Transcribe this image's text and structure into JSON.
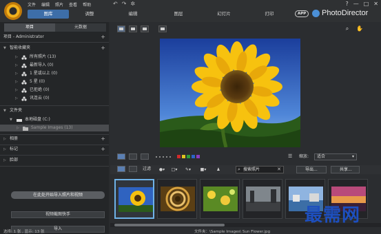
{
  "menu": [
    "文件",
    "编辑",
    "照片",
    "查看",
    "帮助"
  ],
  "window_controls": [
    "?",
    "—",
    "□",
    "✕"
  ],
  "main_tabs": [
    "图库",
    "调整",
    "编辑",
    "图层",
    "幻灯片",
    "打印"
  ],
  "app_badge": "APP",
  "brand": "PhotoDirector",
  "left": {
    "tabs": [
      "项目",
      "元数据"
    ],
    "project_label": "项目 - Administrator",
    "smart_collections": "智能收藏夹",
    "smart_items": [
      "所有照片 (13)",
      "最新导入 (0)",
      "1 星或以上 (0)",
      "5 星 (0)",
      "已拒绝 (0)",
      "讯连云 (0)"
    ],
    "folders": "文件夹",
    "local_disk": "本地磁盘 (C:)",
    "sample_folder": "Sample Images (13)",
    "albums": "相册",
    "tags": "标记",
    "faces": "脸部",
    "start_button": "在此处开始导入照片和视频",
    "video_button": "视频截图快手",
    "import_button": "导入"
  },
  "filmstrip": {
    "zoom_label": "缩放:",
    "zoom_value": "适合",
    "swatch_colors": [
      "#d02a2a",
      "#e0c420",
      "#2c9e3a",
      "#2d63c8",
      "#8a3cc0"
    ]
  },
  "filter": {
    "filter_label": "过滤",
    "search_placeholder": "搜索照片",
    "export_label": "导出...",
    "share_label": "共享..."
  },
  "status": {
    "left": "选择: 1 张 , 显示: 13 张",
    "right": "文件夹：\\Sample Images\\ Sun Flower.jpg"
  },
  "watermark": "最需网"
}
